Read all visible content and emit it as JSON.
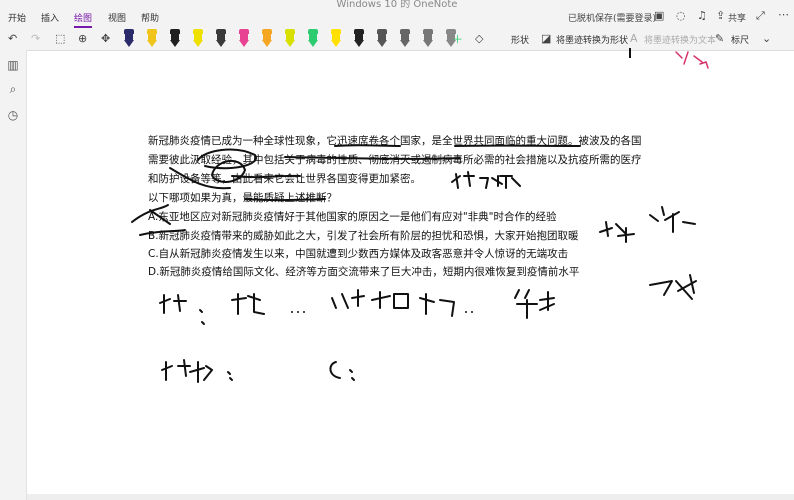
{
  "window": {
    "title": "Windows 10 的 OneNote"
  },
  "menu": {
    "tabs": [
      "开始",
      "插入",
      "绘图",
      "视图",
      "帮助"
    ],
    "active_index": 2
  },
  "titlebar_right": {
    "sync_status": "已脱机保存(需要登录)",
    "share_label": "共享"
  },
  "ribbon": {
    "shape_label": "形状",
    "ink_to_shape_label": "将墨迹转换为形状",
    "ink_to_text_label": "将墨迹转换为文本",
    "ruler_label": "标尺",
    "pens": [
      {
        "color": "#2b2b6b",
        "name": "pen-dark-blue"
      },
      {
        "color": "#f0c419",
        "name": "pen-yellow"
      },
      {
        "color": "#1f1f1f",
        "name": "pen-black"
      },
      {
        "color": "#f0e000",
        "name": "pen-yellow-2"
      },
      {
        "color": "#3a3a3a",
        "name": "pen-gray"
      },
      {
        "color": "#e84393",
        "name": "pen-pink"
      },
      {
        "color": "#f5a623",
        "name": "pen-orange"
      },
      {
        "color": "#d8e000",
        "name": "pen-lime"
      },
      {
        "color": "#2ecc71",
        "name": "pen-green"
      },
      {
        "color": "#ffe000",
        "name": "highlighter-yellow"
      },
      {
        "color": "#222222",
        "name": "pen-black-selected"
      },
      {
        "color": "#555555",
        "name": "pen-dark-gray"
      },
      {
        "color": "#666666",
        "name": "pen-gray-2"
      },
      {
        "color": "#777777",
        "name": "pen-gray-3"
      },
      {
        "color": "#888888",
        "name": "pen-gray-4"
      }
    ]
  },
  "document": {
    "lines": [
      "新冠肺炎疫情已成为一种全球性现象，它迅速席卷各个国家，是全世界共同面临的重大问题。被波及的各国",
      "需要彼此汲取经验，其中包括关于病毒的性质、彻底消灭或遏制病毒所必需的社会措施以及抗疫所需的医疗",
      "和防护设备等等，由此看来它会让世界各国变得更加紧密。",
      "以下哪项如果为真，最能质疑上述推断？",
      "A.东亚地区应对新冠肺炎疫情好于其他国家的原因之一是他们有应对\"非典\"时合作的经验",
      "B.新冠肺炎疫情带来的威胁如此之大，引发了社会所有阶层的担忧和恐惧，大家开始抱团取暖",
      "C.自从新冠肺炎疫情发生以来，中国就遭到少数西方媒体及政客恶意并令人惊讶的无端攻击",
      "D.新冠肺炎疫情给国际文化、经济等方面交流带来了巨大冲击，短期内很难恢复到疫情前水平"
    ]
  },
  "handwriting": {
    "keyword_note": "找关键词",
    "support_note": "支持 ✓ ✗",
    "rebuttal_note": "反驳",
    "premise_note": "论点：新冠…… 让世界各国…… 紧密",
    "evidence_note": "论据：    C："
  }
}
